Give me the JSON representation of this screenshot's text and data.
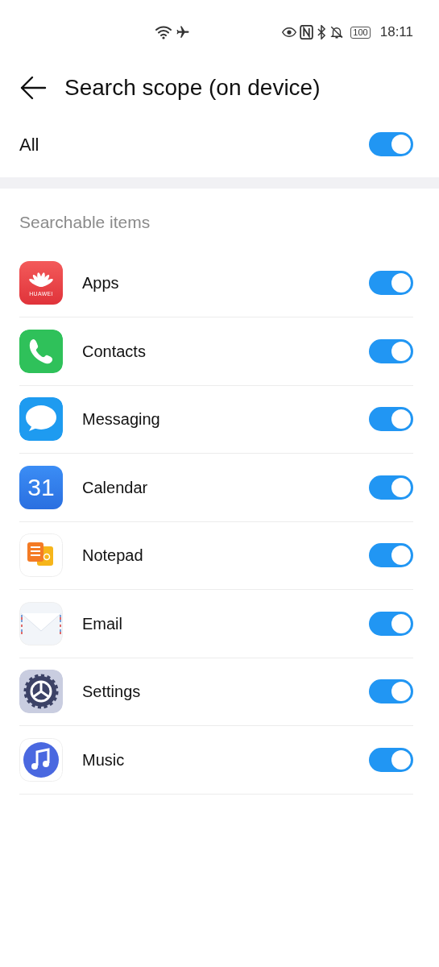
{
  "status_bar": {
    "battery": "100",
    "time": "18:11"
  },
  "header": {
    "title": "Search scope (on device)"
  },
  "all": {
    "label": "All",
    "on": true
  },
  "section": {
    "title": "Searchable items"
  },
  "items": [
    {
      "kind": "apps",
      "label": "Apps",
      "icon_text": "HUAWEI",
      "on": true
    },
    {
      "kind": "contacts",
      "label": "Contacts",
      "on": true
    },
    {
      "kind": "messaging",
      "label": "Messaging",
      "on": true
    },
    {
      "kind": "calendar",
      "label": "Calendar",
      "icon_text": "31",
      "on": true
    },
    {
      "kind": "notepad",
      "label": "Notepad",
      "on": true
    },
    {
      "kind": "email",
      "label": "Email",
      "on": true
    },
    {
      "kind": "settings",
      "label": "Settings",
      "on": true
    },
    {
      "kind": "music",
      "label": "Music",
      "on": true
    }
  ]
}
